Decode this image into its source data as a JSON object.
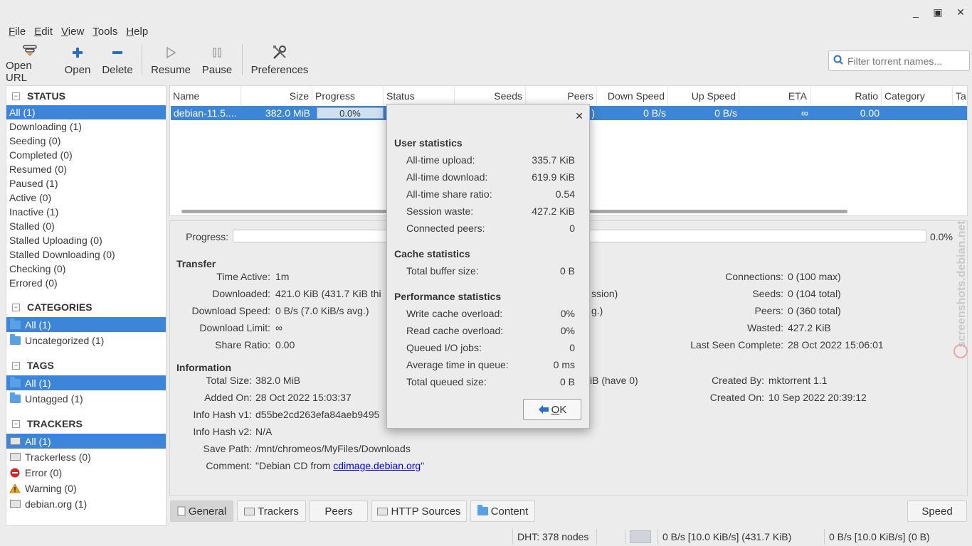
{
  "window": {
    "minimize": "_",
    "maximize": "▣",
    "close": "✕"
  },
  "menu": [
    "File",
    "Edit",
    "View",
    "Tools",
    "Help"
  ],
  "toolbar": {
    "open_url": "Open URL",
    "open": "Open",
    "delete": "Delete",
    "resume": "Resume",
    "pause": "Pause",
    "preferences": "Preferences",
    "filter_placeholder": "Filter torrent names..."
  },
  "sidebar": {
    "status_title": "STATUS",
    "status_items": [
      "All (1)",
      "Downloading (1)",
      "Seeding (0)",
      "Completed (0)",
      "Resumed (0)",
      "Paused (1)",
      "Active (0)",
      "Inactive (1)",
      "Stalled (0)",
      "Stalled Uploading (0)",
      "Stalled Downloading (0)",
      "Checking (0)",
      "Errored (0)"
    ],
    "categories_title": "CATEGORIES",
    "categories_items": [
      "All (1)",
      "Uncategorized (1)"
    ],
    "tags_title": "TAGS",
    "tags_items": [
      "All (1)",
      "Untagged (1)"
    ],
    "trackers_title": "TRACKERS",
    "trackers_items": [
      "All (1)",
      "Trackerless (0)",
      "Error (0)",
      "Warning (0)",
      "debian.org (1)"
    ]
  },
  "list": {
    "columns": [
      "Name",
      "Size",
      "Progress",
      "Status",
      "Seeds",
      "Peers",
      "Down Speed",
      "Up Speed",
      "ETA",
      "Ratio",
      "Category",
      "Ta"
    ],
    "row": {
      "name": "debian-11.5....",
      "size": "382.0 MiB",
      "progress": "0.0%",
      "peers_tail": ")",
      "down_speed": "0 B/s",
      "up_speed": "0 B/s",
      "eta": "∞",
      "ratio": "0.00",
      "progress_fraction": 0.0
    }
  },
  "details": {
    "progress_label": "Progress:",
    "progress_value": "0.0%",
    "transfer_title": "Transfer",
    "time_active_label": "Time Active:",
    "time_active": "1m",
    "downloaded_label": "Downloaded:",
    "downloaded": "421.0 KiB (431.7 KiB thi",
    "downloaded_tail": "ssion)",
    "download_speed_label": "Download Speed:",
    "download_speed": "0 B/s (7.0 KiB/s avg.)",
    "upload_speed_tail": "g.)",
    "download_limit_label": "Download Limit:",
    "download_limit": "∞",
    "share_ratio_label": "Share Ratio:",
    "share_ratio": "0.00",
    "connections_label": "Connections:",
    "connections": "0 (100 max)",
    "seeds_label": "Seeds:",
    "seeds": "0 (104 total)",
    "peers_label": "Peers:",
    "peers": "0 (360 total)",
    "wasted_label": "Wasted:",
    "wasted": "427.2 KiB",
    "last_seen_label": "Last Seen Complete:",
    "last_seen": "28 Oct 2022 15:06:01",
    "information_title": "Information",
    "total_size_label": "Total Size:",
    "total_size": "382.0 MiB",
    "pieces_tail": "iB (have 0)",
    "added_on_label": "Added On:",
    "added_on": "28 Oct 2022 15:03:37",
    "hash_v1_label": "Info Hash v1:",
    "hash_v1": "d55be2cd263efa84aeb9495",
    "hash_v2_label": "Info Hash v2:",
    "hash_v2": "N/A",
    "save_path_label": "Save Path:",
    "save_path": "/mnt/chromeos/MyFiles/Downloads",
    "comment_label": "Comment:",
    "comment_prefix": "\"Debian CD from ",
    "comment_link": "cdimage.debian.org",
    "comment_suffix": "\"",
    "created_by_label": "Created By:",
    "created_by": "mktorrent 1.1",
    "created_on_label": "Created On:",
    "created_on": "10 Sep 2022 20:39:12"
  },
  "tabs": [
    "General",
    "Trackers",
    "Peers",
    "HTTP Sources",
    "Content"
  ],
  "speed_button": "Speed",
  "statusbar": {
    "dht": "DHT: 378 nodes",
    "down": "0 B/s [10.0 KiB/s] (431.7 KiB)",
    "up": "0 B/s [10.0 KiB/s] (0 B)"
  },
  "dialog": {
    "close": "✕",
    "user_title": "User statistics",
    "alltime_upload_label": "All-time upload:",
    "alltime_upload": "335.7 KiB",
    "alltime_download_label": "All-time download:",
    "alltime_download": "619.9 KiB",
    "share_ratio_label": "All-time share ratio:",
    "share_ratio": "0.54",
    "session_waste_label": "Session waste:",
    "session_waste": "427.2 KiB",
    "connected_peers_label": "Connected peers:",
    "connected_peers": "0",
    "cache_title": "Cache statistics",
    "buffer_label": "Total buffer size:",
    "buffer": "0 B",
    "perf_title": "Performance statistics",
    "write_overload_label": "Write cache overload:",
    "write_overload": "0%",
    "read_overload_label": "Read cache overload:",
    "read_overload": "0%",
    "queued_jobs_label": "Queued I/O jobs:",
    "queued_jobs": "0",
    "avg_time_label": "Average time in queue:",
    "avg_time": "0 ms",
    "queued_size_label": "Total queued size:",
    "queued_size": "0 B",
    "ok": "OK"
  },
  "watermark": "screenshots.debian.net",
  "colors": {
    "selection": "#3d85d8",
    "background": "#ececec"
  }
}
